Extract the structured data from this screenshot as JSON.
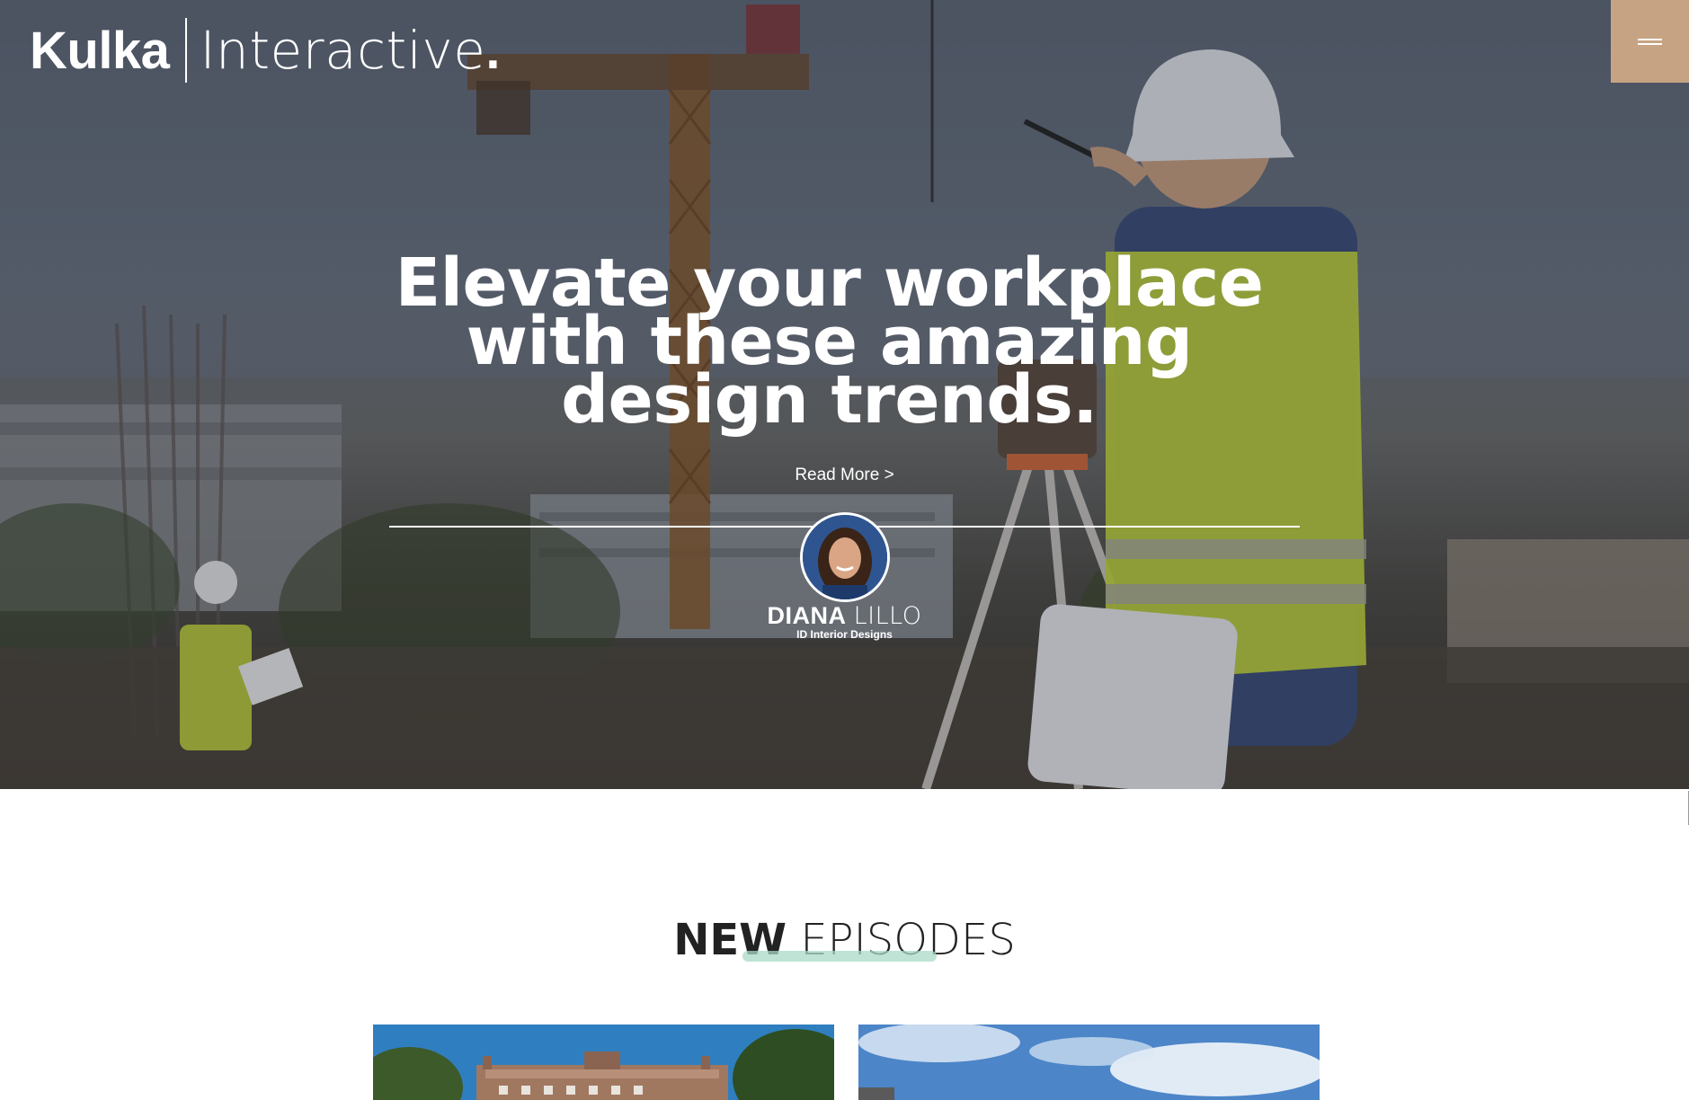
{
  "header": {
    "logo": {
      "brand": "Kulka",
      "sub": "Interactive",
      "dot": "."
    },
    "menu_icon": "hamburger-icon",
    "accent_color": "#c6a483"
  },
  "hero": {
    "headline": "Elevate your workplace with these amazing design trends.",
    "read_more": "Read More  >",
    "author": {
      "first_name": "DIANA",
      "last_name": "LILLO",
      "company": "ID Interior Designs"
    }
  },
  "episodes": {
    "title_bold": "NEW",
    "title_light": " EPISODES",
    "swash_color": "#a9d9c6"
  }
}
